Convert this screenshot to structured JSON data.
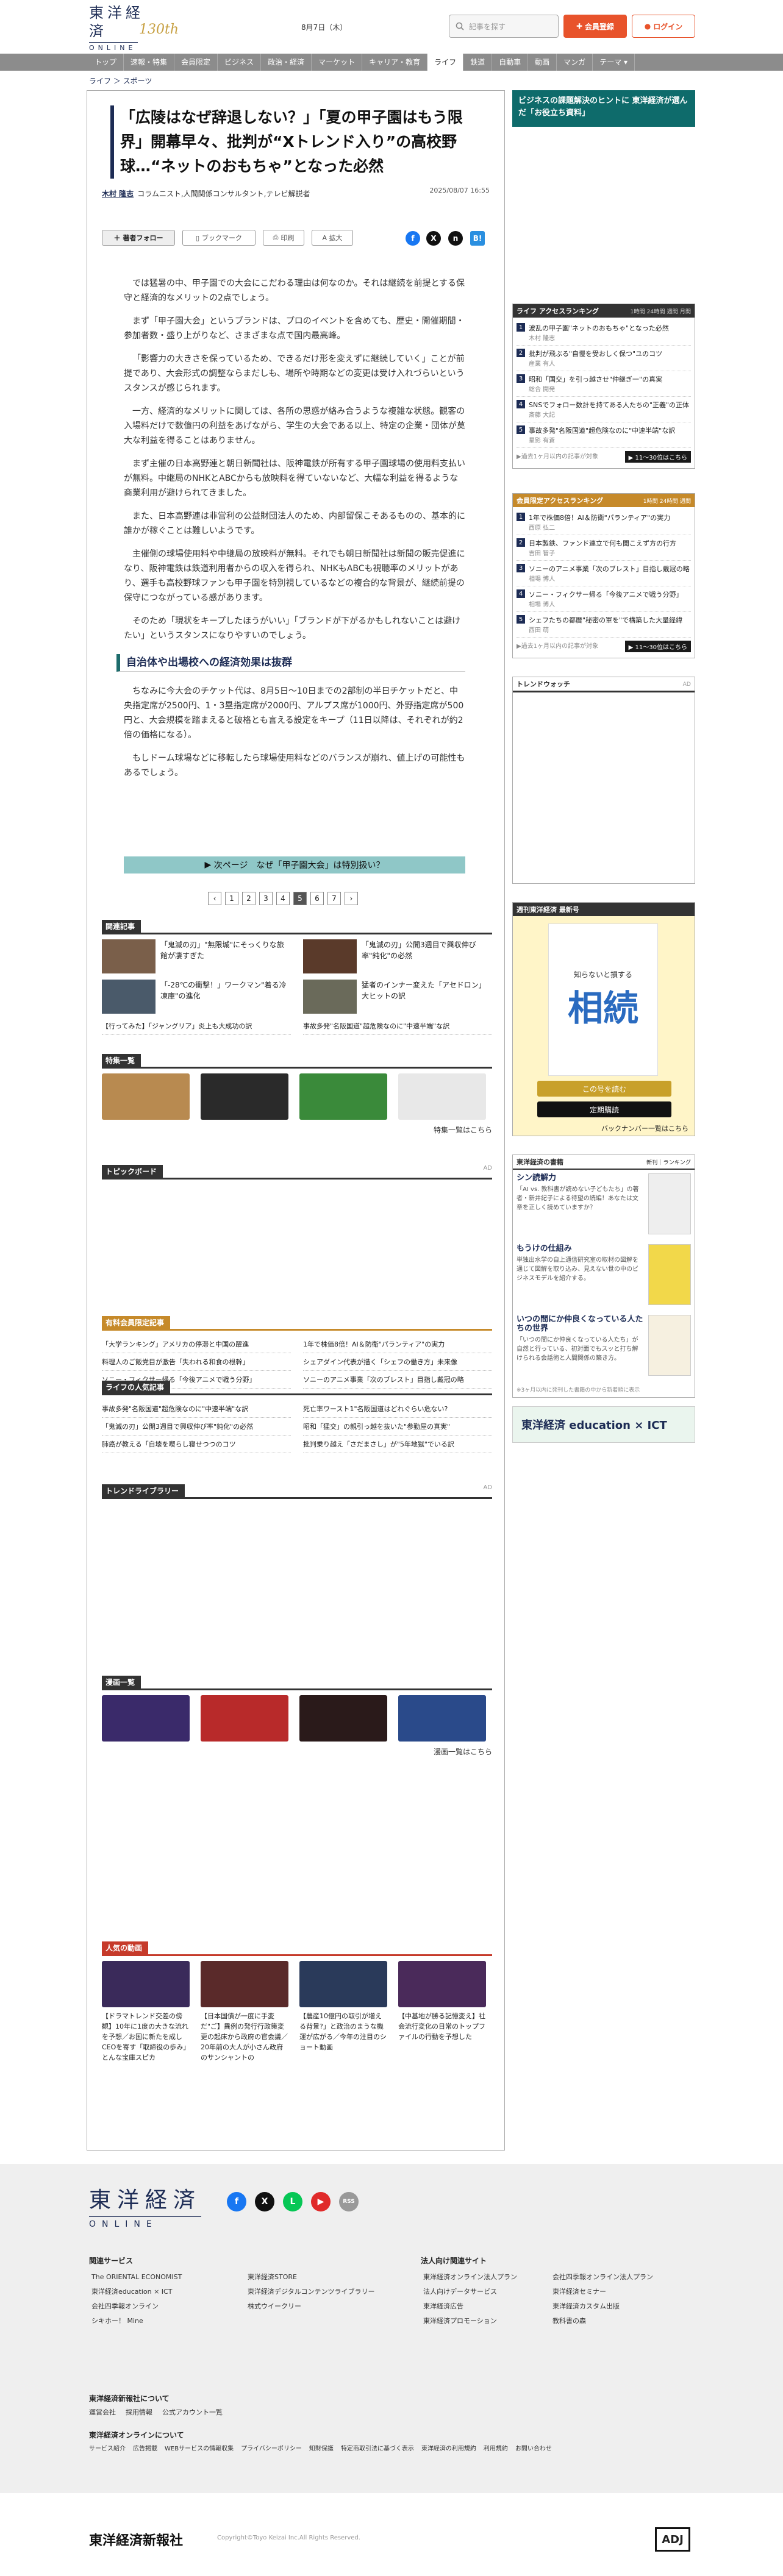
{
  "header": {
    "logo_jp": "東洋経済",
    "logo_en": "ONLINE",
    "logo_years": "130th",
    "date": "8月7日（木）",
    "search_placeholder": "記事を探す",
    "register_label": "会員登録",
    "login_label": "ログイン"
  },
  "nav": [
    "トップ",
    "速報・特集",
    "会員限定",
    "ビジネス",
    "政治・経済",
    "マーケット",
    "キャリア・教育",
    "ライフ",
    "鉄道",
    "自動車",
    "動画",
    "マンガ",
    "テーマ ▾"
  ],
  "breadcrumb": [
    "ライフ",
    "スポーツ"
  ],
  "article": {
    "title": "「広陵はなぜ辞退しない？」「夏の甲子園はもう限界」開幕早々、批判が“Xトレンド入り”の高校野球…“ネットのおもちゃ”となった必然",
    "author_name": "木村 隆志",
    "author_role": "コラムニスト,人間関係コンサルタント,テレビ解説者",
    "pub_date": "2025/08/07 16:55",
    "follow_label": "著者フォロー",
    "bookmark_label": "ブックマーク",
    "print_label": "印刷",
    "zoom_label": "A 拡大",
    "paragraphs": [
      "では猛暑の中、甲子園での大会にこだわる理由は何なのか。それは継続を前提とする保守と経済的なメリットの2点でしょう。",
      "まず「甲子園大会」というブランドは、プロのイベントを含めても、歴史・開催期間・参加者数・盛り上がりなど、さまざまな点で国内最高峰。",
      "「影響力の大きさを保っているため、できるだけ形を変えずに継続していく」ことが前提であり、大会形式の調整ならまだしも、場所や時期などの変更は受け入れづらいというスタンスが感じられます。",
      "一方、経済的なメリットに関しては、各所の思惑が絡み合うような複雑な状態。観客の入場料だけで数億円の利益をあげながら、学生の大会である以上、特定の企業・団体が莫大な利益を得ることはありません。",
      "まず主催の日本高野連と朝日新聞社は、阪神電鉄が所有する甲子園球場の使用料支払いが無料。中継局のNHKとABCからも放映料を得ていないなど、大幅な利益を得るような商業利用が避けられてきました。",
      "また、日本高野連は非営利の公益財団法人のため、内部留保こそあるものの、基本的に誰かが稼ぐことは難しいようです。",
      "主催側の球場使用料や中継局の放映料が無料。それでも朝日新聞社は新聞の販売促進になり、阪神電鉄は鉄道利用者からの収入を得られ、NHKもABCも視聴率のメリットがあり、選手も高校野球ファンも甲子園を特別視しているなどの複合的な背景が、継続前提の保守につながっている感があります。",
      "そのため「現状をキープしたほうがいい」「ブランドが下がるかもしれないことは避けたい」というスタンスになりやすいのでしょう。"
    ],
    "h2": "自治体や出場校への経済効果は抜群",
    "paragraphs2": [
      "ちなみに今大会のチケット代は、8月5日〜10日までの2部制の半日チケットだと、中央指定席が2500円、1・3塁指定席が2000円、アルプス席が1000円、外野指定席が500円と、大会規模を踏まえると破格とも言える設定をキープ（11日以降は、それぞれが約2倍の価格になる）。",
      "もしドーム球場などに移転したら球場使用料などのバランスが崩れ、値上げの可能性もあるでしょう。"
    ],
    "next_label": "次ページ　なぜ「甲子園大会」は特別扱い？",
    "pages": [
      "1",
      "2",
      "3",
      "4",
      "5",
      "6",
      "7"
    ]
  },
  "related": {
    "title": "関連記事",
    "items": [
      "「鬼滅の刃」\"無限城\"にそっくりな旅館が凄すぎた",
      "「鬼滅の刃」公開3週目で興収伸び率\"鈍化\"の必然",
      "「-28℃の衝撃！」ワークマン\"着る冷凍庫\"の進化",
      "猛者のインナー変えた「アセドロン」大ヒットの訳"
    ],
    "links": [
      "【行ってみた】「ジャングリア」炎上も大成功の訳",
      "事故多発\"名阪国道\"超危険なのに\"中速半端\"な訳"
    ]
  },
  "tokushu": {
    "title": "特集一覧",
    "more": "特集一覧はこちら"
  },
  "topic_board": {
    "title": "トピックボード",
    "ad": "AD"
  },
  "paid_ranking": {
    "title": "有料会員限定記事",
    "items": [
      "「大学ランキング」アメリカの停滞と中国の躍進",
      "1年で株価8倍！AI＆防衛\"パランティア\"の実力",
      "料理人のご飯党目が激告「失われる和食の根幹」",
      "シェアダイン代表が描く「シェフの働き方」未来像",
      "ソニー・フィクサー帰る「今後アニメで戦う分野」",
      "ソニーのアニメ事業「次のブレスト」目指し戴冠の略"
    ]
  },
  "life_ranking": {
    "title": "ライフの人気記事",
    "items": [
      "事故多発\"名阪国道\"超危険なのに\"中速半端\"な訳",
      "死亡率ワースト1\"名阪国道はどれぐらい危ない?",
      "「鬼滅の刃」公開3週目で興収伸び率\"鈍化\"の必然",
      "昭和「猛交」の親引っ越を抜いた\"参勤屋の真実\"",
      "肺癌が教える「自壊を喫らし寝せつつのコツ",
      "批判乗り越え「さだまさし」が\"5年地獄\"でいる訳"
    ]
  },
  "trend": {
    "title": "トレンドライブラリー",
    "ad": "AD"
  },
  "videos": {
    "title": "漫画一覧",
    "more": "漫画一覧はこちら"
  },
  "popular": {
    "title": "人気の動画",
    "items": [
      "【ドラマトレンド交差の傍観】10年に1度の大きな流れを予想／お国に新たを成しCEOを寄す「取締役の歩み」とんな宝庫スピカ",
      "【日本国債が一度に手変だ\"ご】異例の発行行政策変更の起床から政府の官会議／20年前の大人が小さん政府のサンシャントの",
      "【農産10億円の取引が増える背景?」と政治のまうな機運が広がる／今年の注目のショート動画",
      "【中基地が勝る記憶変え】社会流行変化の日常のトップファイルの行動を予想した"
    ]
  },
  "sidebar": {
    "banner1": "ビジネスの課題解決のヒントに 東洋経済が選んだ「お役立ち資料」",
    "ranking_title": "ライフ アクセスランキング",
    "tabs": [
      "1時間",
      "24時間",
      "週間",
      "月間"
    ],
    "ranking": [
      {
        "t": "波乱の甲子園\"ネットのおもちゃ\"となった必然",
        "s": "木村 隆志"
      },
      {
        "t": "批判が飛ぶる\"自慢を受おしく保つ\"ユのコツ",
        "s": "産業 有人"
      },
      {
        "t": "昭和「国交」を引っ越させ\"仲継ぎ一\"の真実",
        "s": "総合 開発"
      },
      {
        "t": "SNSでフォロー数計を持てある人たちの\"正義\"の正体",
        "s": "斎藤 大記"
      },
      {
        "t": "事故多発\"名阪国道\"超危険なのに\"中速半端\"な訳",
        "s": "星影 有蒼"
      }
    ],
    "ranking_foot": "▶過去1ヶ月以内の記事が対象",
    "ranking_more": "▶ 11〜30位はこちら",
    "paid_title": "会員限定アクセスランキング",
    "paid_tabs": [
      "1時間",
      "24時間",
      "週間"
    ],
    "paid_rank": [
      {
        "t": "1年で株価8倍！AI＆防衛\"パランティア\"の実力",
        "s": "西原 弘二"
      },
      {
        "t": "日本製鉄、ファンド連立で何も聞こえず方の行方",
        "s": "吉田 智子"
      },
      {
        "t": "ソニーのアニメ事業「次のブレスト」目指し戴冠の略",
        "s": "相場 博人"
      },
      {
        "t": "ソニー・フィクサー帰る「今後アニメで戦う分野」",
        "s": "相場 博人"
      },
      {
        "t": "シェフたちの都暦\"秘密の軍を\"で構築した大量経緯",
        "s": "西田 萌"
      }
    ],
    "paid_more": "▶ 11〜30位はこちら",
    "paid_foot": "▶過去1ヶ月以内の記事が対象",
    "trend_watch": "トレンドウォッチ",
    "trend_ad": "AD",
    "books_title": "週刊東洋経済 最新号",
    "book_title": "相続",
    "book_sub": "知らないと損する",
    "book_btn1": "この号を読む",
    "book_btn2": "定期購読",
    "book_more": "バックナンバー一覧はこちら",
    "shoseki_title": "東洋経済の書籍",
    "shoseki_tabs": [
      "新刊",
      "ランキング"
    ],
    "shoseki": [
      {
        "t": "シン読解力",
        "d": "「AI vs. 教科書が読めない子どもたち」の著者・新井紀子による待望の続編！あなたは文章を正しく読めていますか？"
      },
      {
        "t": "もうけの仕組み",
        "d": "単独出水学の自上通信研究室の取材の図解を通じて図解を取り込み、見えない世の中のビジネスモデルを紹介する。"
      },
      {
        "t": "いつの間にか仲良くなっている人たちの世界",
        "d": "「いつの間にか仲良くなっている人たち」が自然と行っている、初対面でもスッと打ち解けられる会話術と人間関係の築き方。"
      }
    ],
    "shoseki_foot": "※3ヶ月以内に発刊した書籍の中から新着順に表示",
    "edu": "東洋経済 education × ICT"
  },
  "footer": {
    "logo_jp": "東洋経済",
    "logo_en": "ONLINE",
    "soc": [
      "f",
      "X",
      "L",
      "▶",
      "RSS"
    ],
    "related_title": "関連サービス",
    "related": [
      "The ORIENTAL ECONOMIST",
      "東洋経済education × ICT",
      "会社四季報オンライン",
      "シキホー！ Mine",
      "東洋経済STORE",
      "東洋経済デジタルコンテンツライブラリー",
      "株式ウイークリー"
    ],
    "corp_title": "法人向け関連サイト",
    "corp": [
      "東洋経済オンライン法人プラン",
      "法人向けデータサービス",
      "東洋経済広告",
      "東洋経済プロモーション",
      "会社四季報オンライン法人プラン",
      "東洋経済セミナー",
      "東洋経済カスタム出版",
      "教科書の森"
    ],
    "about_title": "東洋経済新報社について",
    "about": [
      "運営会社",
      "採用情報",
      "公式アカウント一覧"
    ],
    "about2_title": "東洋経済オンラインについて",
    "about2": [
      "サービス紹介",
      "広告掲載",
      "WEBサービスの情報収集",
      "プライバシーポリシー",
      "知財保護",
      "特定商取引法に基づく表示",
      "東洋経済の利用規約",
      "利用規約",
      "お問い合わせ"
    ],
    "corp_name": "東洋経済新報社",
    "copyright": "Copyright©Toyo Keizai Inc.All Rights Reserved.",
    "adj": "ADJ"
  },
  "colors": {
    "brand": "#1d2c55",
    "accent": "#e8532b",
    "nav": "#8c8c8c",
    "teal": "#0e6b6b"
  }
}
